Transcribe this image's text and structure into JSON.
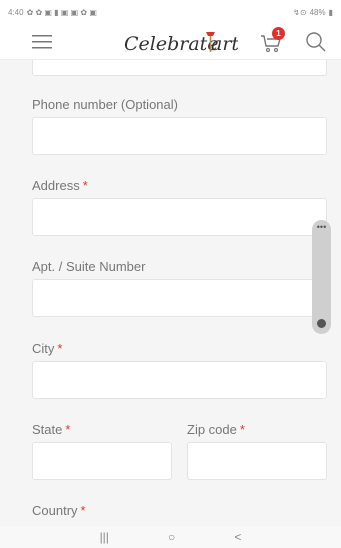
{
  "status_bar": {
    "time": "4:40",
    "battery": "48%"
  },
  "header": {
    "cart_count": "1",
    "brand": "Celebrate",
    "brand_accent": "art"
  },
  "form": {
    "fields": [
      {
        "label": "Phone number (Optional)",
        "required": false
      },
      {
        "label": "Address",
        "required": true
      },
      {
        "label": "Apt. / Suite Number",
        "required": false
      },
      {
        "label": "City",
        "required": true
      },
      {
        "label": "State",
        "required": true
      },
      {
        "label": "Zip code",
        "required": true
      },
      {
        "label": "Country",
        "required": true
      }
    ],
    "required_marker": "*"
  },
  "nav": {
    "recents": "|||",
    "home": "○",
    "back": "<"
  },
  "colors": {
    "accent": "#d9342b",
    "required": "#e0342f",
    "form_bg": "#f5f5f5"
  }
}
